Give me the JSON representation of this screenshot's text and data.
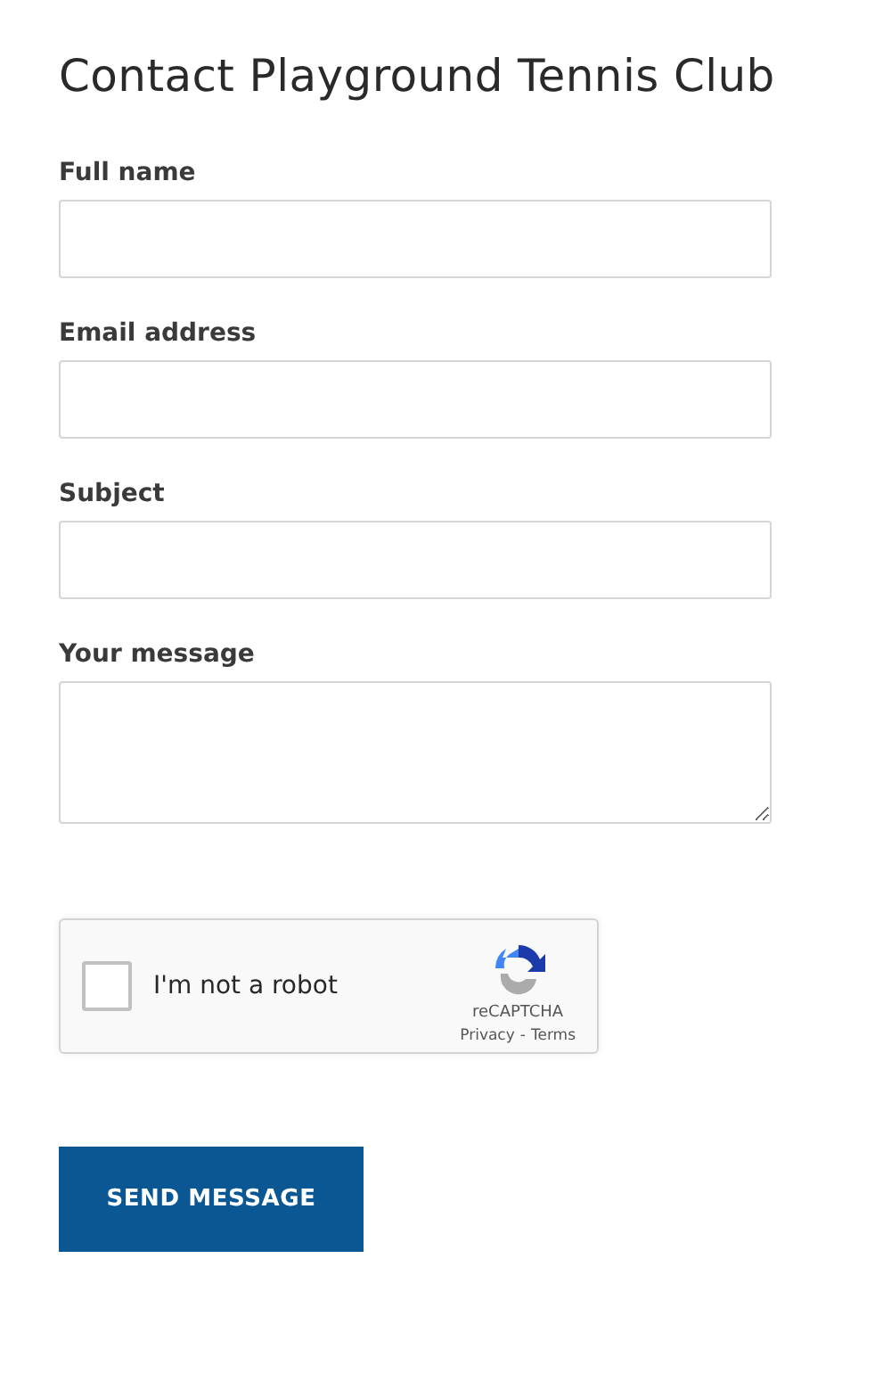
{
  "title": "Contact Playground Tennis Club",
  "fields": [
    {
      "label": "Full name",
      "kind": "input"
    },
    {
      "label": "Email address",
      "kind": "input"
    },
    {
      "label": "Subject",
      "kind": "input"
    },
    {
      "label": "Your message",
      "kind": "textarea"
    }
  ],
  "captcha": {
    "label": "I'm not a robot",
    "checked": false,
    "brand": "reCAPTCHA",
    "links": [
      "Privacy",
      "Terms"
    ],
    "separator": "-"
  },
  "submit": "SEND MESSAGE"
}
